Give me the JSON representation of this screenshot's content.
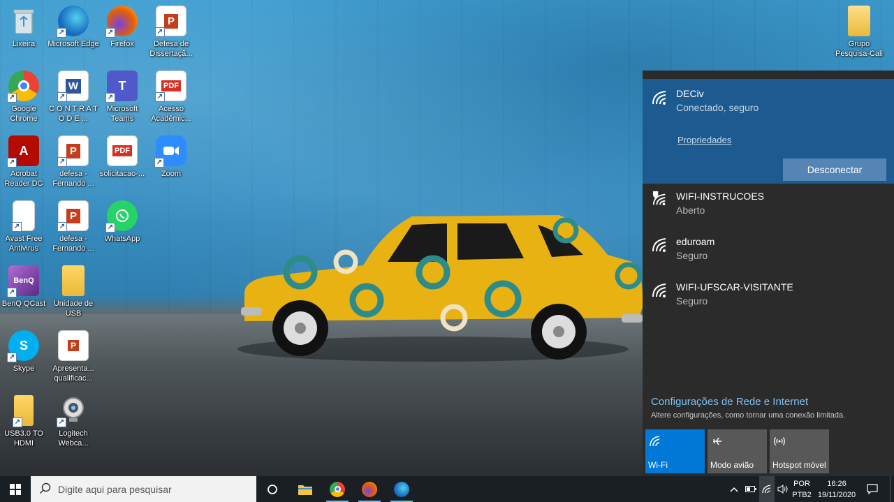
{
  "desktop_icons": [
    {
      "label": "Lixeira",
      "icon": "recycle-bin-icon"
    },
    {
      "label": "Microsoft Edge",
      "icon": "edge-icon"
    },
    {
      "label": "Firefox",
      "icon": "firefox-icon"
    },
    {
      "label": "Defesa de Dissertaçã...",
      "icon": "powerpoint-icon"
    },
    {
      "label": "Google Chrome",
      "icon": "chrome-icon"
    },
    {
      "label": "C O N T R A T O   D E ...",
      "icon": "word-icon"
    },
    {
      "label": "Microsoft Teams",
      "icon": "teams-icon"
    },
    {
      "label": "Acesso Acadêmic...",
      "icon": "pdf-icon"
    },
    {
      "label": "Acrobat Reader DC",
      "icon": "acrobat-icon"
    },
    {
      "label": "defesa - Fernando ...",
      "icon": "powerpoint-icon"
    },
    {
      "label": "solicitacao-...",
      "icon": "pdf-icon"
    },
    {
      "label": "Zoom",
      "icon": "zoom-icon"
    },
    {
      "label": "Avast Free Antivirus",
      "icon": "blank-document-icon"
    },
    {
      "label": "defesa - Fernando ...",
      "icon": "presentation-icon"
    },
    {
      "label": "WhatsApp",
      "icon": "whatsapp-icon"
    },
    {
      "label": "BenQ QCast",
      "icon": "benq-qcast-icon"
    },
    {
      "label": "Unidade de USB",
      "icon": "folder-icon"
    },
    {
      "label": "Skype",
      "icon": "skype-icon"
    },
    {
      "label": "Apresenta... qualificac...",
      "icon": "powerpoint-file-icon"
    },
    {
      "label": "USB3.0 TO HDMI",
      "icon": "folder-icon"
    },
    {
      "label": "Logitech Webca...",
      "icon": "webcam-icon"
    },
    {
      "label": "Grupo Pesquisa-Cali",
      "icon": "folder-icon"
    }
  ],
  "network_flyout": {
    "connected": {
      "name": "DECiv",
      "status": "Conectado, seguro",
      "properties_link": "Propriedades",
      "disconnect_label": "Desconectar"
    },
    "networks": [
      {
        "name": "WIFI-INSTRUCOES",
        "status": "Aberto",
        "icon": "wifi-open-warning-icon"
      },
      {
        "name": "eduroam",
        "status": "Seguro",
        "icon": "wifi-icon"
      },
      {
        "name": "WIFI-UFSCAR-VISITANTE",
        "status": "Seguro",
        "icon": "wifi-icon"
      }
    ],
    "settings_link": "Configurações de Rede e Internet",
    "settings_desc": "Altere configurações, como tornar uma conexão limitada.",
    "quick_actions": [
      {
        "label": "Wi-Fi",
        "icon": "wifi-icon",
        "active": true
      },
      {
        "label": "Modo avião",
        "icon": "airplane-icon",
        "active": false
      },
      {
        "label": "Hotspot móvel",
        "icon": "hotspot-icon",
        "active": false
      }
    ]
  },
  "taskbar": {
    "search_placeholder": "Digite aqui para pesquisar",
    "apps": [
      "task-view-icon",
      "file-explorer-icon",
      "chrome-icon",
      "firefox-icon",
      "edge-icon"
    ],
    "language": {
      "line1": "POR",
      "line2": "PTB2"
    },
    "time": "16:26",
    "date": "19/11/2020"
  },
  "colors": {
    "accent": "#0078d7",
    "flyout_bg": "#2b2b2b",
    "connected_bg": "#1c5a8f",
    "taskbar_bg": "#1a1f24"
  }
}
